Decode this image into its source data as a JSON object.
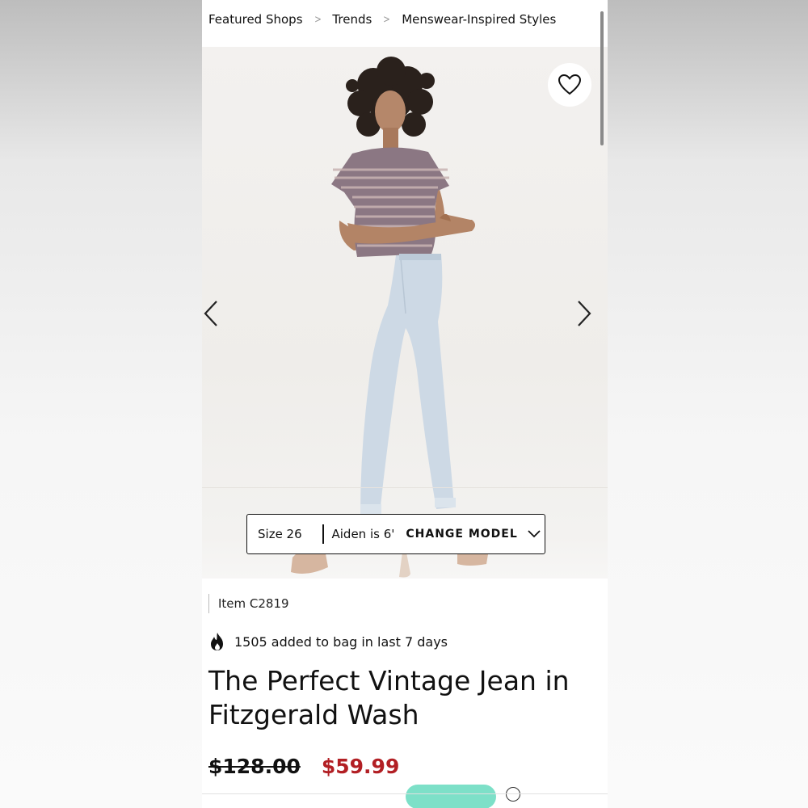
{
  "breadcrumb": {
    "items": [
      "Featured Shops",
      "Trends",
      "Menswear-Inspired Styles"
    ],
    "separator": ">"
  },
  "gallery": {
    "wishlist_icon": "heart-outline-icon",
    "prev_icon": "chevron-left-icon",
    "next_icon": "chevron-right-icon",
    "image_subject": "model wearing striped tee and light wash jeans"
  },
  "model_bar": {
    "size": "Size 26",
    "model": "Aiden is 6'",
    "change_label": "CHANGE MODEL",
    "dropdown_icon": "chevron-down-icon"
  },
  "product": {
    "item_number": "Item C2819",
    "social_proof": "1505 added to bag in last 7 days",
    "social_icon": "flame-icon",
    "title": "The Perfect Vintage Jean in Fitzgerald Wash",
    "original_price": "$128.00",
    "sale_price": "$59.99"
  },
  "colors": {
    "sale_red": "#b21f24",
    "promo_mint": "#7de0c8"
  }
}
